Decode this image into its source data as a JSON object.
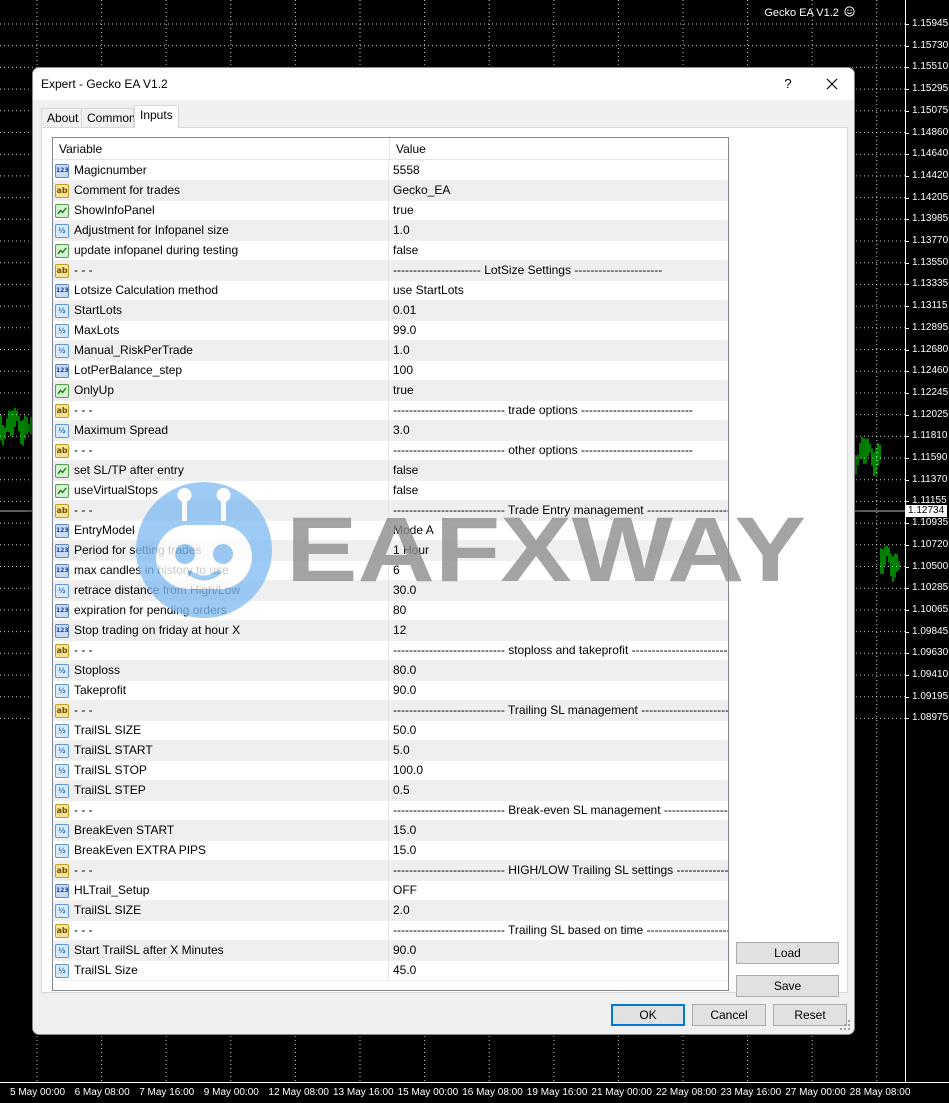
{
  "chart": {
    "indicator_label": "Gecko EA V1.2",
    "smiley_icon": "smiley-face-icon",
    "price_ticks": [
      "1.15945",
      "1.15730",
      "1.15510",
      "1.15295",
      "1.15075",
      "1.14860",
      "1.14640",
      "1.14420",
      "1.14205",
      "1.13985",
      "1.13770",
      "1.13550",
      "1.13335",
      "1.13115",
      "1.12895",
      "1.12680",
      "1.12460",
      "1.12245",
      "1.12025",
      "1.11810",
      "1.11590",
      "1.11370",
      "1.11155",
      "1.10935",
      "1.10720",
      "1.10500",
      "1.10285",
      "1.10065",
      "1.09845",
      "1.09630",
      "1.09410",
      "1.09195",
      "1.08975"
    ],
    "current_price": "1.12734",
    "time_ticks": [
      "5 May 00:00",
      "6 May 08:00",
      "7 May 16:00",
      "9 May 00:00",
      "12 May 08:00",
      "13 May 16:00",
      "15 May 00:00",
      "16 May 08:00",
      "19 May 16:00",
      "21 May 00:00",
      "22 May 08:00",
      "23 May 16:00",
      "27 May 00:00",
      "28 May 08:00"
    ],
    "colors": {
      "background": "#000000",
      "bull_candle": "#00ff00",
      "grid": "#ffffff"
    }
  },
  "dialog": {
    "title": "Expert - Gecko EA V1.2",
    "help_label": "?",
    "tabs": [
      {
        "label": "About",
        "active": false
      },
      {
        "label": "Common",
        "active": false
      },
      {
        "label": "Inputs",
        "active": true
      }
    ],
    "grid": {
      "col_variable": "Variable",
      "col_value": "Value",
      "rows": [
        {
          "type": "int",
          "variable": "Magicnumber",
          "value": "5558"
        },
        {
          "type": "str",
          "variable": "Comment for trades",
          "value": "Gecko_EA"
        },
        {
          "type": "bool",
          "variable": "ShowInfoPanel",
          "value": "true"
        },
        {
          "type": "dbl",
          "variable": "Adjustment for Infopanel size",
          "value": "1.0"
        },
        {
          "type": "bool",
          "variable": "update infopanel during testing",
          "value": "false"
        },
        {
          "type": "str",
          "variable": "- - -",
          "value": "---------------------- LotSize Settings ----------------------"
        },
        {
          "type": "int",
          "variable": "Lotsize Calculation method",
          "value": "use StartLots"
        },
        {
          "type": "dbl",
          "variable": "StartLots",
          "value": "0.01"
        },
        {
          "type": "dbl",
          "variable": "MaxLots",
          "value": "99.0"
        },
        {
          "type": "dbl",
          "variable": "Manual_RiskPerTrade",
          "value": "1.0"
        },
        {
          "type": "int",
          "variable": "LotPerBalance_step",
          "value": "100"
        },
        {
          "type": "bool",
          "variable": "OnlyUp",
          "value": "true"
        },
        {
          "type": "str",
          "variable": "- - -",
          "value": "---------------------------- trade options ----------------------------"
        },
        {
          "type": "dbl",
          "variable": "Maximum Spread",
          "value": "3.0"
        },
        {
          "type": "str",
          "variable": "- - -",
          "value": "---------------------------- other options ----------------------------"
        },
        {
          "type": "bool",
          "variable": "set SL/TP after entry",
          "value": "false"
        },
        {
          "type": "bool",
          "variable": "useVirtualStops",
          "value": "false"
        },
        {
          "type": "str",
          "variable": "- - -",
          "value": "---------------------------- Trade Entry management ----------------------------"
        },
        {
          "type": "int",
          "variable": "EntryModel",
          "value": "Mode A"
        },
        {
          "type": "int",
          "variable": "Period for setting trades",
          "value": "1 Hour"
        },
        {
          "type": "int",
          "variable": "max candles in history to use",
          "value": "6"
        },
        {
          "type": "dbl",
          "variable": "retrace distance from High/Low",
          "value": "30.0"
        },
        {
          "type": "int",
          "variable": "expiration for pending orders",
          "value": "80"
        },
        {
          "type": "int",
          "variable": "Stop trading on friday at hour X",
          "value": "12"
        },
        {
          "type": "str",
          "variable": "- - -",
          "value": "---------------------------- stoploss and takeprofit ----------------------------"
        },
        {
          "type": "dbl",
          "variable": "Stoploss",
          "value": "80.0"
        },
        {
          "type": "dbl",
          "variable": "Takeprofit",
          "value": "90.0"
        },
        {
          "type": "str",
          "variable": "- - -",
          "value": "---------------------------- Trailing SL management ----------------------------"
        },
        {
          "type": "dbl",
          "variable": "TrailSL SIZE",
          "value": "50.0"
        },
        {
          "type": "dbl",
          "variable": "TrailSL START",
          "value": "5.0"
        },
        {
          "type": "dbl",
          "variable": "TrailSL STOP",
          "value": "100.0"
        },
        {
          "type": "dbl",
          "variable": "TrailSL STEP",
          "value": "0.5"
        },
        {
          "type": "str",
          "variable": "- - -",
          "value": "---------------------------- Break-even SL management ----------------------------"
        },
        {
          "type": "dbl",
          "variable": "BreakEven START",
          "value": "15.0"
        },
        {
          "type": "dbl",
          "variable": "BreakEven EXTRA PIPS",
          "value": "15.0"
        },
        {
          "type": "str",
          "variable": "- - -",
          "value": "---------------------------- HIGH/LOW Trailing SL settings ----------------------------..."
        },
        {
          "type": "int",
          "variable": "HLTrail_Setup",
          "value": "OFF"
        },
        {
          "type": "dbl",
          "variable": "TrailSL SIZE",
          "value": "2.0"
        },
        {
          "type": "str",
          "variable": "- - -",
          "value": "---------------------------- Trailing SL based on time ----------------------------"
        },
        {
          "type": "dbl",
          "variable": "Start TrailSL after X Minutes",
          "value": "90.0"
        },
        {
          "type": "dbl",
          "variable": "TrailSL Size",
          "value": "45.0"
        }
      ]
    },
    "icon_labels": {
      "int": "123",
      "dbl": "½",
      "str": "ab"
    },
    "buttons": {
      "load": "Load",
      "save": "Save",
      "ok": "OK",
      "cancel": "Cancel",
      "reset": "Reset"
    }
  },
  "watermark": {
    "text": "EAFXWAY"
  }
}
